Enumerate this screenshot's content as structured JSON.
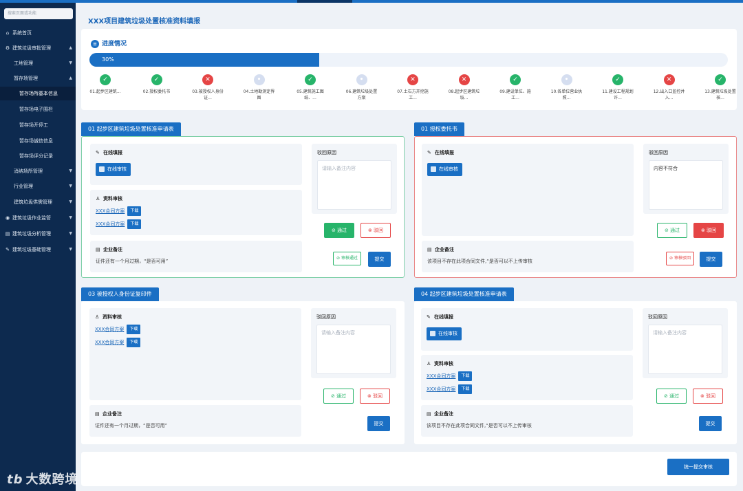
{
  "sidebar": {
    "search_placeholder": "搜索页面或功能",
    "items": [
      {
        "icon": "⌂",
        "label": "系统首页"
      },
      {
        "icon": "⚙",
        "label": "建筑垃圾审批管理"
      },
      {
        "label": "工地管理"
      },
      {
        "label": "暂存场管理"
      },
      {
        "label": "暂存场所基本信息"
      },
      {
        "label": "暂存场电子围栏"
      },
      {
        "label": "暂存场开停工"
      },
      {
        "label": "暂存场诚信信息"
      },
      {
        "label": "暂存场评分记录"
      },
      {
        "label": "消纳场所管理"
      },
      {
        "label": "行业管理"
      },
      {
        "label": "建筑垃圾供需管理"
      },
      {
        "icon": "◉",
        "label": "建筑垃圾作业监管"
      },
      {
        "icon": "▤",
        "label": "建筑垃圾分析管理"
      },
      {
        "icon": "✎",
        "label": "建筑垃圾基础管理"
      }
    ]
  },
  "watermark": {
    "logo": "tb",
    "text": "大数跨境"
  },
  "page": {
    "title": "XXX项目建筑垃圾处置核准资料填报"
  },
  "progress": {
    "title": "进度情况",
    "percent_label": "30%",
    "percent": 0.3,
    "steps": [
      {
        "status": "ok",
        "label": "01.起步区建筑..."
      },
      {
        "status": "ok",
        "label": "02.授权委托书"
      },
      {
        "status": "bad",
        "label": "03.被授权人身份证..."
      },
      {
        "status": "pending",
        "label": "04.土地勘测定界图"
      },
      {
        "status": "ok",
        "label": "05.建筑施工图纸、..."
      },
      {
        "status": "pending",
        "label": "06.建筑垃圾处置方案"
      },
      {
        "status": "bad",
        "label": "07.土石方开挖施工..."
      },
      {
        "status": "bad",
        "label": "08.起步区建筑垃圾..."
      },
      {
        "status": "ok",
        "label": "09.建设单位、施工..."
      },
      {
        "status": "pending",
        "label": "10.各单位营业执照..."
      },
      {
        "status": "ok",
        "label": "11.建设工程规划许..."
      },
      {
        "status": "bad",
        "label": "12.出入口监控并入..."
      },
      {
        "status": "ok",
        "label": "13.建筑垃圾处置核..."
      }
    ]
  },
  "common": {
    "online_fill": "在线填报",
    "online_review": "在线审核",
    "material_review": "资料审核",
    "enterprise_note": "企业备注",
    "reject_reason": "驳回原因",
    "reason_placeholder": "请输入备注内容",
    "pass": "通过",
    "reject": "驳回",
    "submit": "提交",
    "download": "下载",
    "doc_name": "XXX合同方案"
  },
  "cards": [
    {
      "head": "01  起步区建筑垃圾处置核准申请表",
      "note": "证件还有一个月过期，“是否可用”",
      "status_badge": "审核通过"
    },
    {
      "head": "01  授权委托书",
      "note": "该项目不存在此项合同文件,“是否可以不上传审核",
      "reason_value": "内容不符合",
      "status_badge": "审核驳回"
    },
    {
      "head": "03  被授权人身份证复印件",
      "note": "证件还有一个月过期，“是否可用”"
    },
    {
      "head": "04  起步区建筑垃圾处置核准申请表",
      "note": "该项目不存在此项合同文件,“是否可以不上传审核"
    }
  ],
  "footer": {
    "submit_all": "统一提交审核"
  },
  "colors": {
    "primary": "#1a6fc4",
    "success": "#27b46a",
    "danger": "#e54545",
    "sidebar": "#0d2a4f"
  }
}
